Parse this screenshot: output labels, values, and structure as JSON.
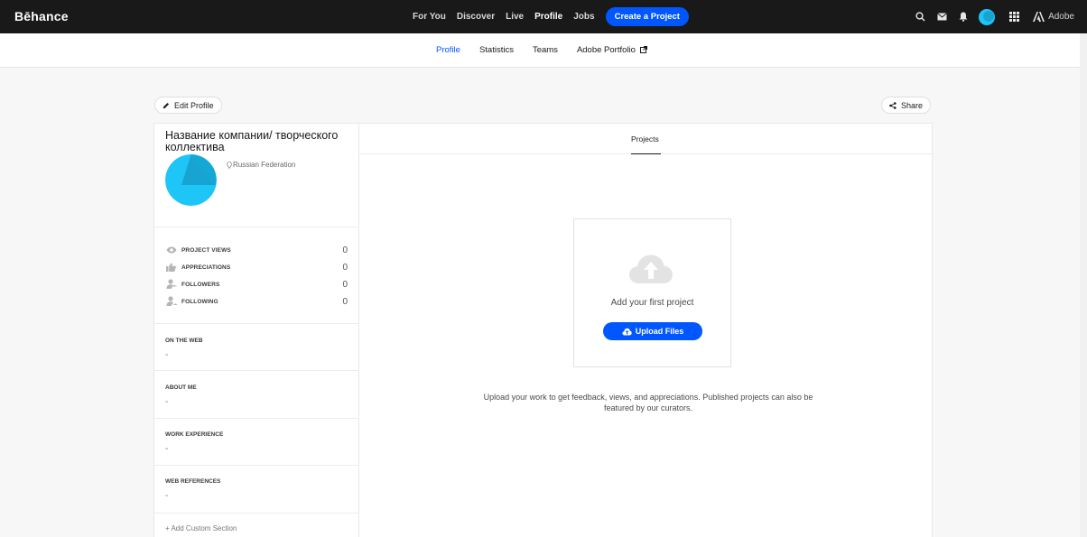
{
  "brand": {
    "logo": "Bēhance",
    "accent": "#0057ff",
    "avatar_color": "#1ec6f7"
  },
  "nav": {
    "links": [
      "For You",
      "Discover",
      "Live",
      "Profile",
      "Jobs"
    ],
    "active": "Profile",
    "create_label": "Create a Project",
    "adobe_label": "Adobe",
    "icons": [
      "search-icon",
      "mail-icon",
      "bell-icon",
      "avatar",
      "apps-grid-icon",
      "adobe-logo-icon"
    ]
  },
  "subnav": {
    "items": [
      "Profile",
      "Statistics",
      "Teams",
      "Adobe Portfolio"
    ],
    "active": "Profile"
  },
  "actions": {
    "edit_profile": "Edit Profile",
    "share": "Share"
  },
  "profile": {
    "name": "Название компании/ творческого коллектива",
    "location": "Russian Federation",
    "stats": [
      {
        "label": "PROJECT VIEWS",
        "value": "0",
        "icon": "eye-icon"
      },
      {
        "label": "APPRECIATIONS",
        "value": "0",
        "icon": "thumbs-up-icon"
      },
      {
        "label": "FOLLOWERS",
        "value": "0",
        "icon": "followers-icon"
      },
      {
        "label": "FOLLOWING",
        "value": "0",
        "icon": "following-icon"
      }
    ],
    "sections": [
      {
        "title": "ON THE WEB",
        "value": "-"
      },
      {
        "title": "ABOUT ME",
        "value": "-"
      },
      {
        "title": "WORK EXPERIENCE",
        "value": "-"
      },
      {
        "title": "WEB REFERENCES",
        "value": "-"
      }
    ],
    "add_section": "+ Add Custom Section"
  },
  "main": {
    "tab": "Projects",
    "empty_title": "Add your first project",
    "upload_label": "Upload Files",
    "hint": "Upload your work to get feedback, views, and appreciations. Published projects can also be featured by our curators."
  }
}
